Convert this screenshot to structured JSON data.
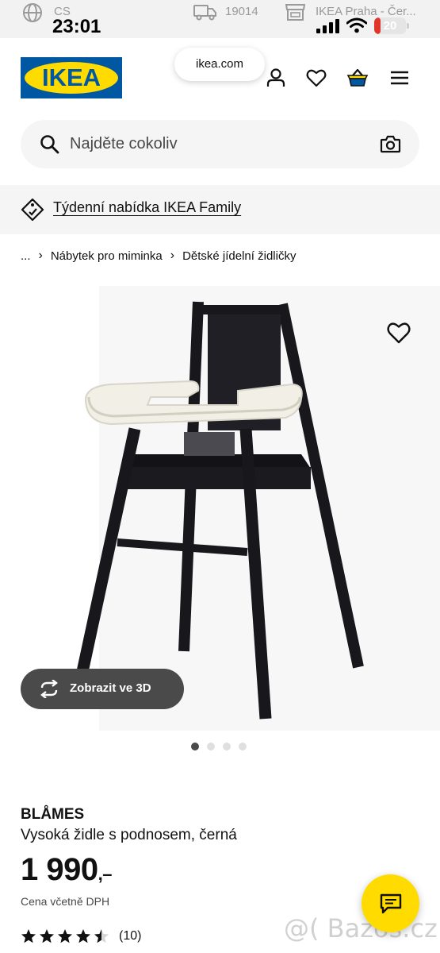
{
  "status_bar": {
    "language": "CS",
    "time": "23:01",
    "notification_count": "19014",
    "app_label": "IKEA Praha - Čer...",
    "battery": "20",
    "battery_level": 0.2
  },
  "header": {
    "logo_text": "IKEA",
    "url": "ikea.com",
    "icons": [
      "user-icon",
      "heart-icon",
      "basket-icon",
      "menu-icon"
    ]
  },
  "search": {
    "placeholder": "Najděte cokoliv"
  },
  "promo": {
    "label": "Týdenní nabídka IKEA Family"
  },
  "breadcrumb": {
    "items": [
      "...",
      "Nábytek pro miminka",
      "Dětské jídelní židličky"
    ]
  },
  "gallery": {
    "view_3d_label": "Zobrazit ve 3D",
    "total_images": 4,
    "active_index": 0
  },
  "product": {
    "name": "BLÅMES",
    "description": "Vysoká židle s podnosem, černá",
    "price": "1 990",
    "price_suffix": ",–",
    "vat_note": "Cena včetně DPH",
    "rating": 4.5,
    "review_count": "(10)"
  },
  "watermark": "@( Bazos.cz",
  "colors": {
    "ikea_blue": "#0058a3",
    "ikea_yellow": "#ffdb00",
    "battery_red": "#e0352b",
    "button_dark": "#4a4a4a"
  }
}
